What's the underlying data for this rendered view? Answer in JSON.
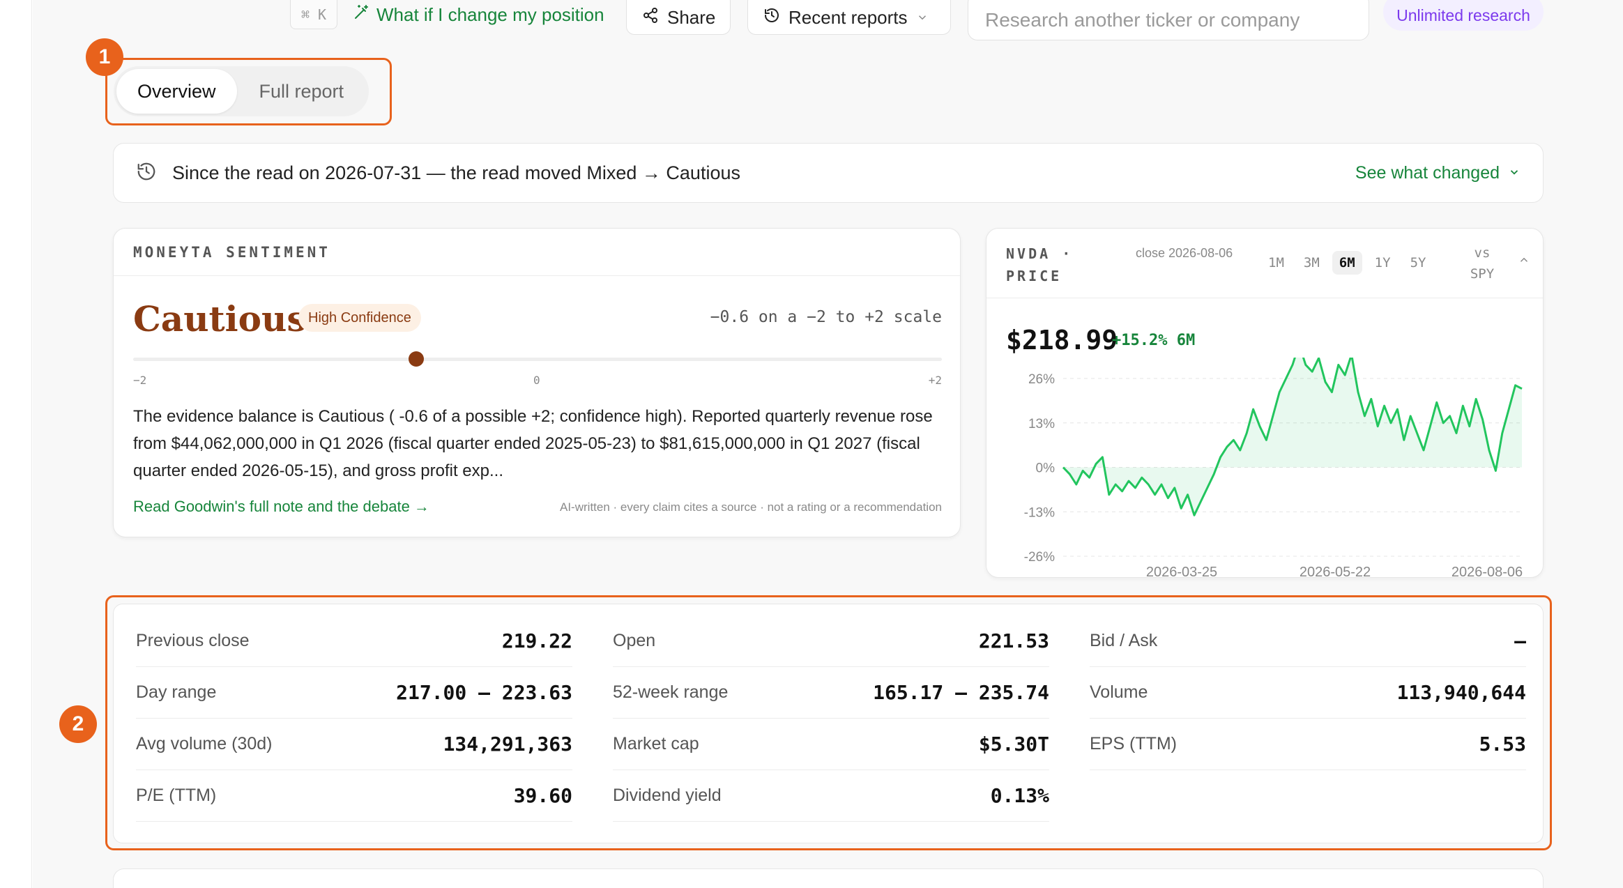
{
  "toolbar": {
    "kbd_hint": "⌘ K",
    "whatif_label": "What if I change my position",
    "share_label": "Share",
    "recent_label": "Recent reports",
    "search_placeholder": "Research another ticker or company",
    "unlimited_label": "Unlimited research"
  },
  "annotations": {
    "badge1": "1",
    "badge2": "2"
  },
  "tabs": [
    {
      "label": "Overview",
      "active": true
    },
    {
      "label": "Full report",
      "active": false
    }
  ],
  "banner": {
    "text": "Since the read on 2026-07-31 — the read moved Mixed → Cautious",
    "link": "See what changed"
  },
  "sentiment": {
    "header": "MONEYTA SENTIMENT",
    "title": "Cautious",
    "confidence": "High Confidence",
    "scale_text": "−0.6 on a −2 to +2 scale",
    "score": -0.6,
    "scale_min_label": "−2",
    "scale_mid_label": "0",
    "scale_max_label": "+2",
    "body": "The evidence balance is Cautious ( -0.6 of a possible +2; confidence high). Reported quarterly revenue rose from $44,062,000,000 in Q1 2026 (fiscal quarter ended 2025-05-23) to $81,615,000,000 in Q1 2027 (fiscal quarter ended 2026-05-15), and gross profit exp...",
    "link": "Read Goodwin's full note and the debate →",
    "note": "AI-written · every claim cites a source · not a rating or a recommendation"
  },
  "price": {
    "title": "NVDA · PRICE",
    "close_label": "close 2026-08-06",
    "ranges": [
      "1M",
      "3M",
      "6M",
      "1Y",
      "5Y"
    ],
    "active_range": "6M",
    "vs_label": "vs SPY",
    "value": "$218.99",
    "change": "+15.2% 6M"
  },
  "colors": {
    "accent_green": "#17853b",
    "line_green": "#22c55e",
    "sentiment_brown": "#8a3b12",
    "highlight": "#e8621c"
  },
  "chart_data": {
    "type": "line",
    "series": [
      {
        "values": [
          0,
          -2,
          -5,
          -1,
          -3,
          1,
          3,
          -8,
          -5,
          -7,
          -4,
          -6,
          -3,
          -5,
          -8,
          -5,
          -9,
          -6,
          -12,
          -8,
          -14,
          -10,
          -6,
          -2,
          3,
          6,
          8,
          5,
          10,
          17,
          12,
          8,
          15,
          22,
          26,
          30,
          36,
          30,
          28,
          32,
          25,
          22,
          30,
          27,
          33,
          22,
          15,
          20,
          12,
          18,
          13,
          17,
          8,
          15,
          10,
          5,
          12,
          19,
          13,
          15,
          10,
          18,
          12,
          20,
          14,
          5,
          -1,
          10,
          17,
          24,
          23
        ],
        "x_start": "2026-02-06",
        "x_end": "2026-08-06"
      }
    ],
    "x_tick_labels": [
      "2026-03-25",
      "2026-05-22",
      "2026-08-06"
    ],
    "y_tick_labels": [
      "26%",
      "13%",
      "0%",
      "-13%",
      "-26%"
    ],
    "ylim": [
      -26,
      26
    ],
    "grid": true
  },
  "stats": [
    [
      {
        "label": "Previous close",
        "value": "219.22"
      },
      {
        "label": "Day range",
        "value": "217.00 – 223.63"
      },
      {
        "label": "Avg volume (30d)",
        "value": "134,291,363"
      },
      {
        "label": "P/E (TTM)",
        "value": "39.60"
      }
    ],
    [
      {
        "label": "Open",
        "value": "221.53"
      },
      {
        "label": "52-week range",
        "value": "165.17 – 235.74"
      },
      {
        "label": "Market cap",
        "value": "$5.30T"
      },
      {
        "label": "Dividend yield",
        "value": "0.13%"
      }
    ],
    [
      {
        "label": "Bid / Ask",
        "value": "—"
      },
      {
        "label": "Volume",
        "value": "113,940,644"
      },
      {
        "label": "EPS (TTM)",
        "value": "5.53"
      }
    ]
  ]
}
